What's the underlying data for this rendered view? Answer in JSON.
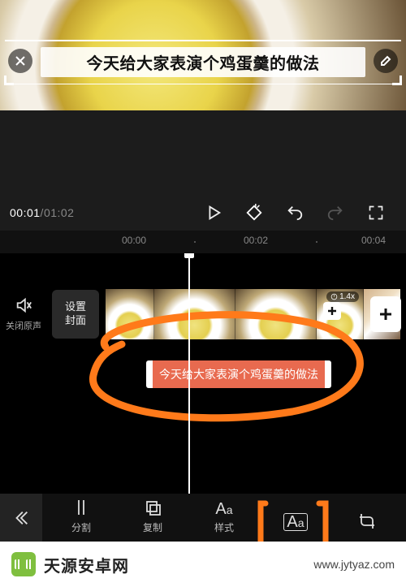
{
  "preview": {
    "caption_text": "今天给大家表演个鸡蛋羹的做法"
  },
  "playback": {
    "current_time": "00:01",
    "duration": "01:02"
  },
  "ruler": {
    "marks": [
      "00:00",
      "00:02",
      "00:04"
    ]
  },
  "timeline": {
    "mute_label": "关闭原声",
    "cover_button": "设置\n封面",
    "speed_badge": "1.4x",
    "caption_clip_text": "今天给大家表演个鸡蛋羹的做法"
  },
  "toolbar": {
    "items": [
      {
        "key": "split",
        "label": "分割"
      },
      {
        "key": "copy",
        "label": "复制"
      },
      {
        "key": "style",
        "label": "样式"
      },
      {
        "key": "font",
        "label": ""
      },
      {
        "key": "crop",
        "label": ""
      }
    ]
  },
  "watermark": {
    "site_name": "天源安卓网",
    "site_url": "www.jytyaz.com"
  }
}
